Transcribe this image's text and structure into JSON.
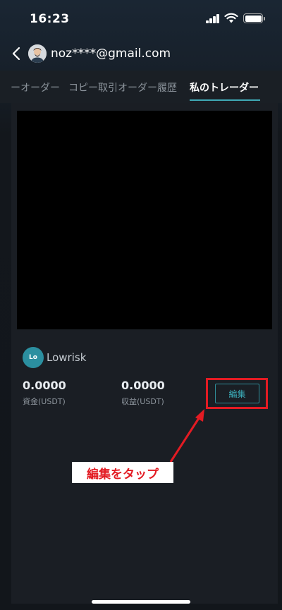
{
  "status_bar": {
    "time": "16:23"
  },
  "header": {
    "title": "noz****@gmail.com"
  },
  "tabs": [
    {
      "label": "ーオーダー"
    },
    {
      "label": "コピー取引オーダー履歴"
    },
    {
      "label": "私のトレーダー"
    }
  ],
  "trader": {
    "avatar_initials": "Lo",
    "name": "Lowrisk",
    "funds_value": "0.0000",
    "funds_label": "資金(USDT)",
    "profit_value": "0.0000",
    "profit_label": "収益(USDT)",
    "edit_label": "編集"
  },
  "annotation": {
    "callout": "編集をタップ"
  },
  "colors": {
    "accent": "#3cb0bd",
    "highlight": "#e31b23",
    "background": "#12161b"
  }
}
